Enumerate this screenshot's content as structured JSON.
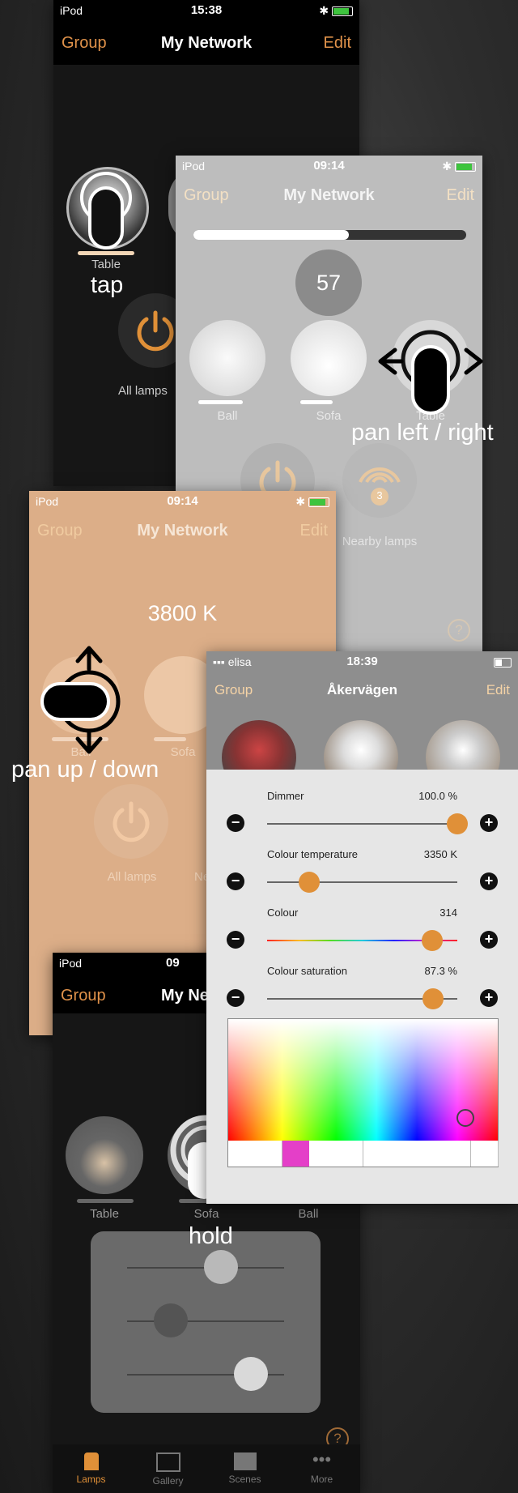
{
  "screen1": {
    "status": {
      "carrier": "iPod",
      "time": "15:38"
    },
    "nav": {
      "left": "Group",
      "title": "My Network",
      "right": "Edit"
    },
    "lamp_label": "Table",
    "power_label": "All lamps"
  },
  "gesture_tap": "tap",
  "screen2": {
    "status": {
      "carrier": "iPod",
      "time": "09:14"
    },
    "nav": {
      "left": "Group",
      "title": "My Network",
      "right": "Edit"
    },
    "progress": 0.57,
    "value_badge": "57",
    "lamps": [
      {
        "label": "Ball"
      },
      {
        "label": "Sofa"
      },
      {
        "label": "Table"
      }
    ],
    "nearby_label": "Nearby lamps",
    "nearby_count": "3",
    "help": "?"
  },
  "gesture_pan_lr": "pan left / right",
  "screen3": {
    "status": {
      "carrier": "iPod",
      "time": "09:14"
    },
    "nav": {
      "left": "Group",
      "title": "My Network",
      "right": "Edit"
    },
    "kelvin": "3800 K",
    "lamps": [
      {
        "label": "Ball"
      },
      {
        "label": "Sofa"
      }
    ],
    "power_label": "All lamps",
    "nearby_partial": "Ne"
  },
  "gesture_pan_ud": "pan up / down",
  "screen4": {
    "status": {
      "carrier": "elisa",
      "time": "18:39"
    },
    "nav": {
      "left": "Group",
      "title": "Åkervägen",
      "right": "Edit"
    },
    "sliders": [
      {
        "label": "Dimmer",
        "value": "100.0 %",
        "level": 1.0
      },
      {
        "label": "Colour temperature",
        "value": "3350 K",
        "level": 0.22
      },
      {
        "label": "Colour",
        "value": "314",
        "level": 0.87
      },
      {
        "label": "Colour saturation",
        "value": "87.3 %",
        "level": 0.873
      }
    ],
    "minus": "−",
    "plus": "+",
    "swatch_count": 10,
    "swatch_selected": 2,
    "swatch_selected_color": "#e43fc8"
  },
  "screen5": {
    "status": {
      "carrier": "iPod",
      "time": "09"
    },
    "nav": {
      "left": "Group",
      "title": "My Ne"
    },
    "lamps": [
      {
        "label": "Table"
      },
      {
        "label": "Sofa"
      },
      {
        "label": "Ball"
      }
    ],
    "panel_levels": [
      0.6,
      0.28,
      0.79
    ],
    "help": "?",
    "tabs": [
      {
        "label": "Lamps"
      },
      {
        "label": "Gallery"
      },
      {
        "label": "Scenes"
      },
      {
        "label": "More"
      }
    ]
  },
  "gesture_hold": "hold",
  "colors": {
    "accent": "#e09038",
    "orange_nav": "#e0924a",
    "peach_bg": "#dcae88"
  }
}
